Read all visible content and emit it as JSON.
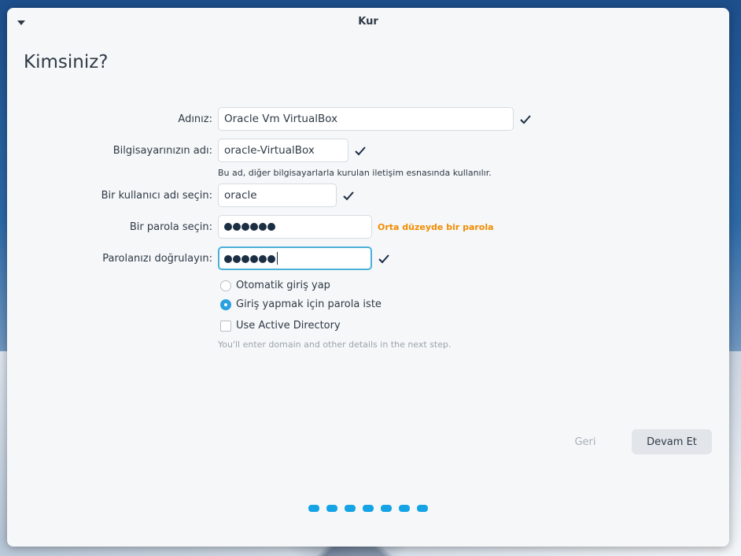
{
  "window": {
    "title": "Kur"
  },
  "page": {
    "heading": "Kimsiniz?"
  },
  "form": {
    "name": {
      "label": "Adınız:",
      "value": "Oracle Vm VirtualBox"
    },
    "computer": {
      "label": "Bilgisayarınızın adı:",
      "value": "oracle-VirtualBox",
      "hint": "Bu ad, diğer bilgisayarlarla kurulan iletişim esnasında kullanılır."
    },
    "username": {
      "label": "Bir kullanıcı adı seçin:",
      "value": "oracle"
    },
    "password": {
      "label": "Bir parola seçin:",
      "masked_length": 6,
      "strength": "Orta düzeyde bir parola"
    },
    "confirm": {
      "label": "Parolanızı doğrulayın:",
      "masked_length": 6
    },
    "login_options": [
      {
        "label": "Otomatik giriş yap",
        "selected": false
      },
      {
        "label": "Giriş yapmak için parola iste",
        "selected": true
      }
    ],
    "active_directory": {
      "label": "Use Active Directory",
      "checked": false,
      "hint": "You'll enter domain and other details in the next step."
    }
  },
  "buttons": {
    "back": "Geri",
    "next": "Devam Et"
  },
  "pager": {
    "total": 7
  },
  "colors": {
    "accent": "#14a4e6",
    "strength_warning": "#f28c00",
    "focus_border": "#4ab0d8"
  }
}
